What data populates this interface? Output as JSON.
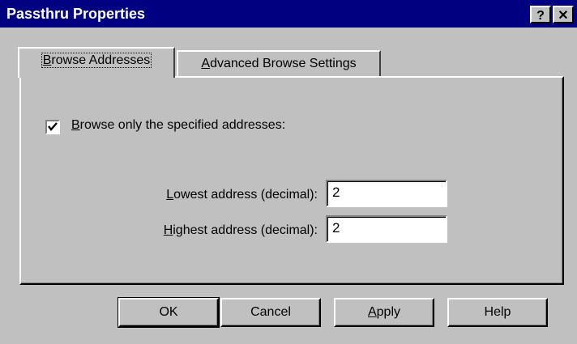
{
  "window": {
    "title": "Passthru Properties",
    "help_glyph": "?",
    "close_glyph": "✕"
  },
  "tabs": [
    {
      "label": "Browse Addresses",
      "mnemonic": "B",
      "rest": "rowse Addresses",
      "active": true
    },
    {
      "label": "Advanced Browse Settings",
      "mnemonic": "A",
      "rest": "dvanced Browse Settings",
      "active": false
    }
  ],
  "browse_only": {
    "checked": true,
    "label": "Browse only the specified addresses:",
    "mnemonic": "B",
    "rest": "rowse only the specified addresses:"
  },
  "fields": {
    "lowest": {
      "label": "Lowest address (decimal):",
      "mnemonic": "L",
      "rest": "owest address (decimal):",
      "value": "2"
    },
    "highest": {
      "label": "Highest address (decimal):",
      "mnemonic": "H",
      "rest": "ighest address (decimal):",
      "value": "2"
    }
  },
  "buttons": {
    "ok": "OK",
    "cancel": "Cancel",
    "apply": {
      "label": "Apply",
      "mnemonic": "A",
      "rest": "pply"
    },
    "help": "Help"
  }
}
